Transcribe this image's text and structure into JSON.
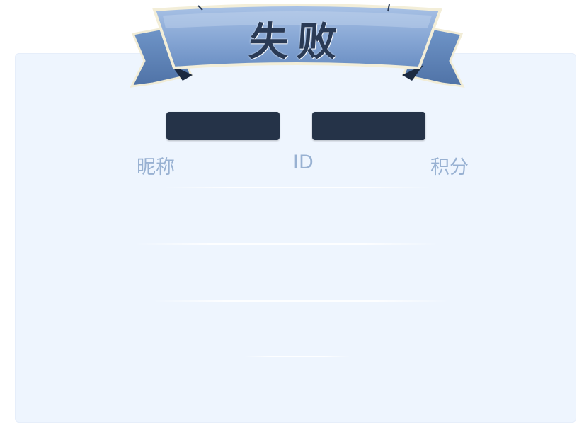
{
  "banner": {
    "title": "失败"
  },
  "buttons": {
    "left_label": "",
    "right_label": ""
  },
  "table": {
    "headers": [
      "昵称",
      "ID",
      "积分"
    ],
    "rows": []
  },
  "colors": {
    "panel_background": "#eef5fe",
    "ribbon_blue": "#7d9fcf",
    "ribbon_dark": "#5377ab",
    "button_dark": "#253348",
    "header_text": "#98b1d2",
    "title_text": "#2a3a55"
  }
}
